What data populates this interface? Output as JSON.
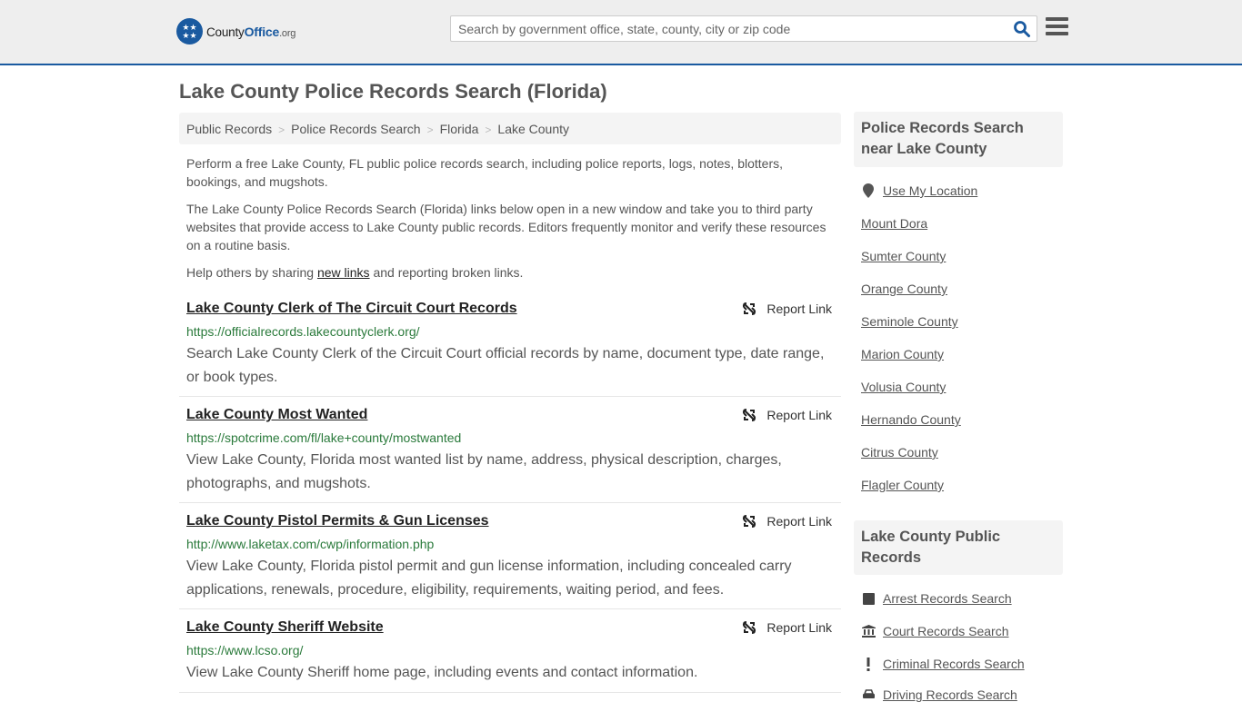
{
  "header": {
    "logo": {
      "county": "County",
      "office": "Office",
      "tld": ".org"
    },
    "search_placeholder": "Search by government office, state, county, city or zip code",
    "search_value": "",
    "search_icon": "magnifier-icon",
    "menu_icon": "hamburger-menu-icon"
  },
  "page": {
    "title": "Lake County Police Records Search (Florida)",
    "breadcrumb": [
      "Public Records",
      "Police Records Search",
      "Florida",
      "Lake County"
    ],
    "intro1": "Perform a free Lake County, FL public police records search, including police reports, logs, notes, blotters, bookings, and mugshots.",
    "intro2": "The Lake County Police Records Search (Florida) links below open in a new window and take you to third party websites that provide access to Lake County public records. Editors frequently monitor and verify these resources on a routine basis.",
    "intro3_before": "Help others by sharing ",
    "intro3_link": "new links",
    "intro3_after": " and reporting broken links."
  },
  "results": [
    {
      "title": "Lake County Clerk of The Circuit Court Records",
      "url": "https://officialrecords.lakecountyclerk.org/",
      "desc": "Search Lake County Clerk of the Circuit Court official records by name, document type, date range, or book types.",
      "report": "Report Link"
    },
    {
      "title": "Lake County Most Wanted",
      "url": "https://spotcrime.com/fl/lake+county/mostwanted",
      "desc": "View Lake County, Florida most wanted list by name, address, physical description, charges, photographs, and mugshots.",
      "report": "Report Link"
    },
    {
      "title": "Lake County Pistol Permits & Gun Licenses",
      "url": "http://www.laketax.com/cwp/information.php",
      "desc": "View Lake County, Florida pistol permit and gun license information, including concealed carry applications, renewals, procedure, eligibility, requirements, waiting period, and fees.",
      "report": "Report Link"
    },
    {
      "title": "Lake County Sheriff Website",
      "url": "https://www.lcso.org/",
      "desc": "View Lake County Sheriff home page, including events and contact information.",
      "report": "Report Link"
    }
  ],
  "sidebar": {
    "nearby_heading": "Police Records Search near Lake County",
    "use_location": "Use My Location",
    "nearby": [
      "Mount Dora",
      "Sumter County",
      "Orange County",
      "Seminole County",
      "Marion County",
      "Volusia County",
      "Hernando County",
      "Citrus County",
      "Flagler County"
    ],
    "public_heading": "Lake County Public Records",
    "public_links": [
      {
        "label": "Arrest Records Search",
        "icon": "square-icon"
      },
      {
        "label": "Court Records Search",
        "icon": "courthouse-icon"
      },
      {
        "label": "Criminal Records Search",
        "icon": "exclamation-icon"
      },
      {
        "label": "Driving Records Search",
        "icon": "car-icon"
      }
    ]
  },
  "colors": {
    "brand": "#1a5aa0",
    "url_green": "#2a7a3b"
  }
}
